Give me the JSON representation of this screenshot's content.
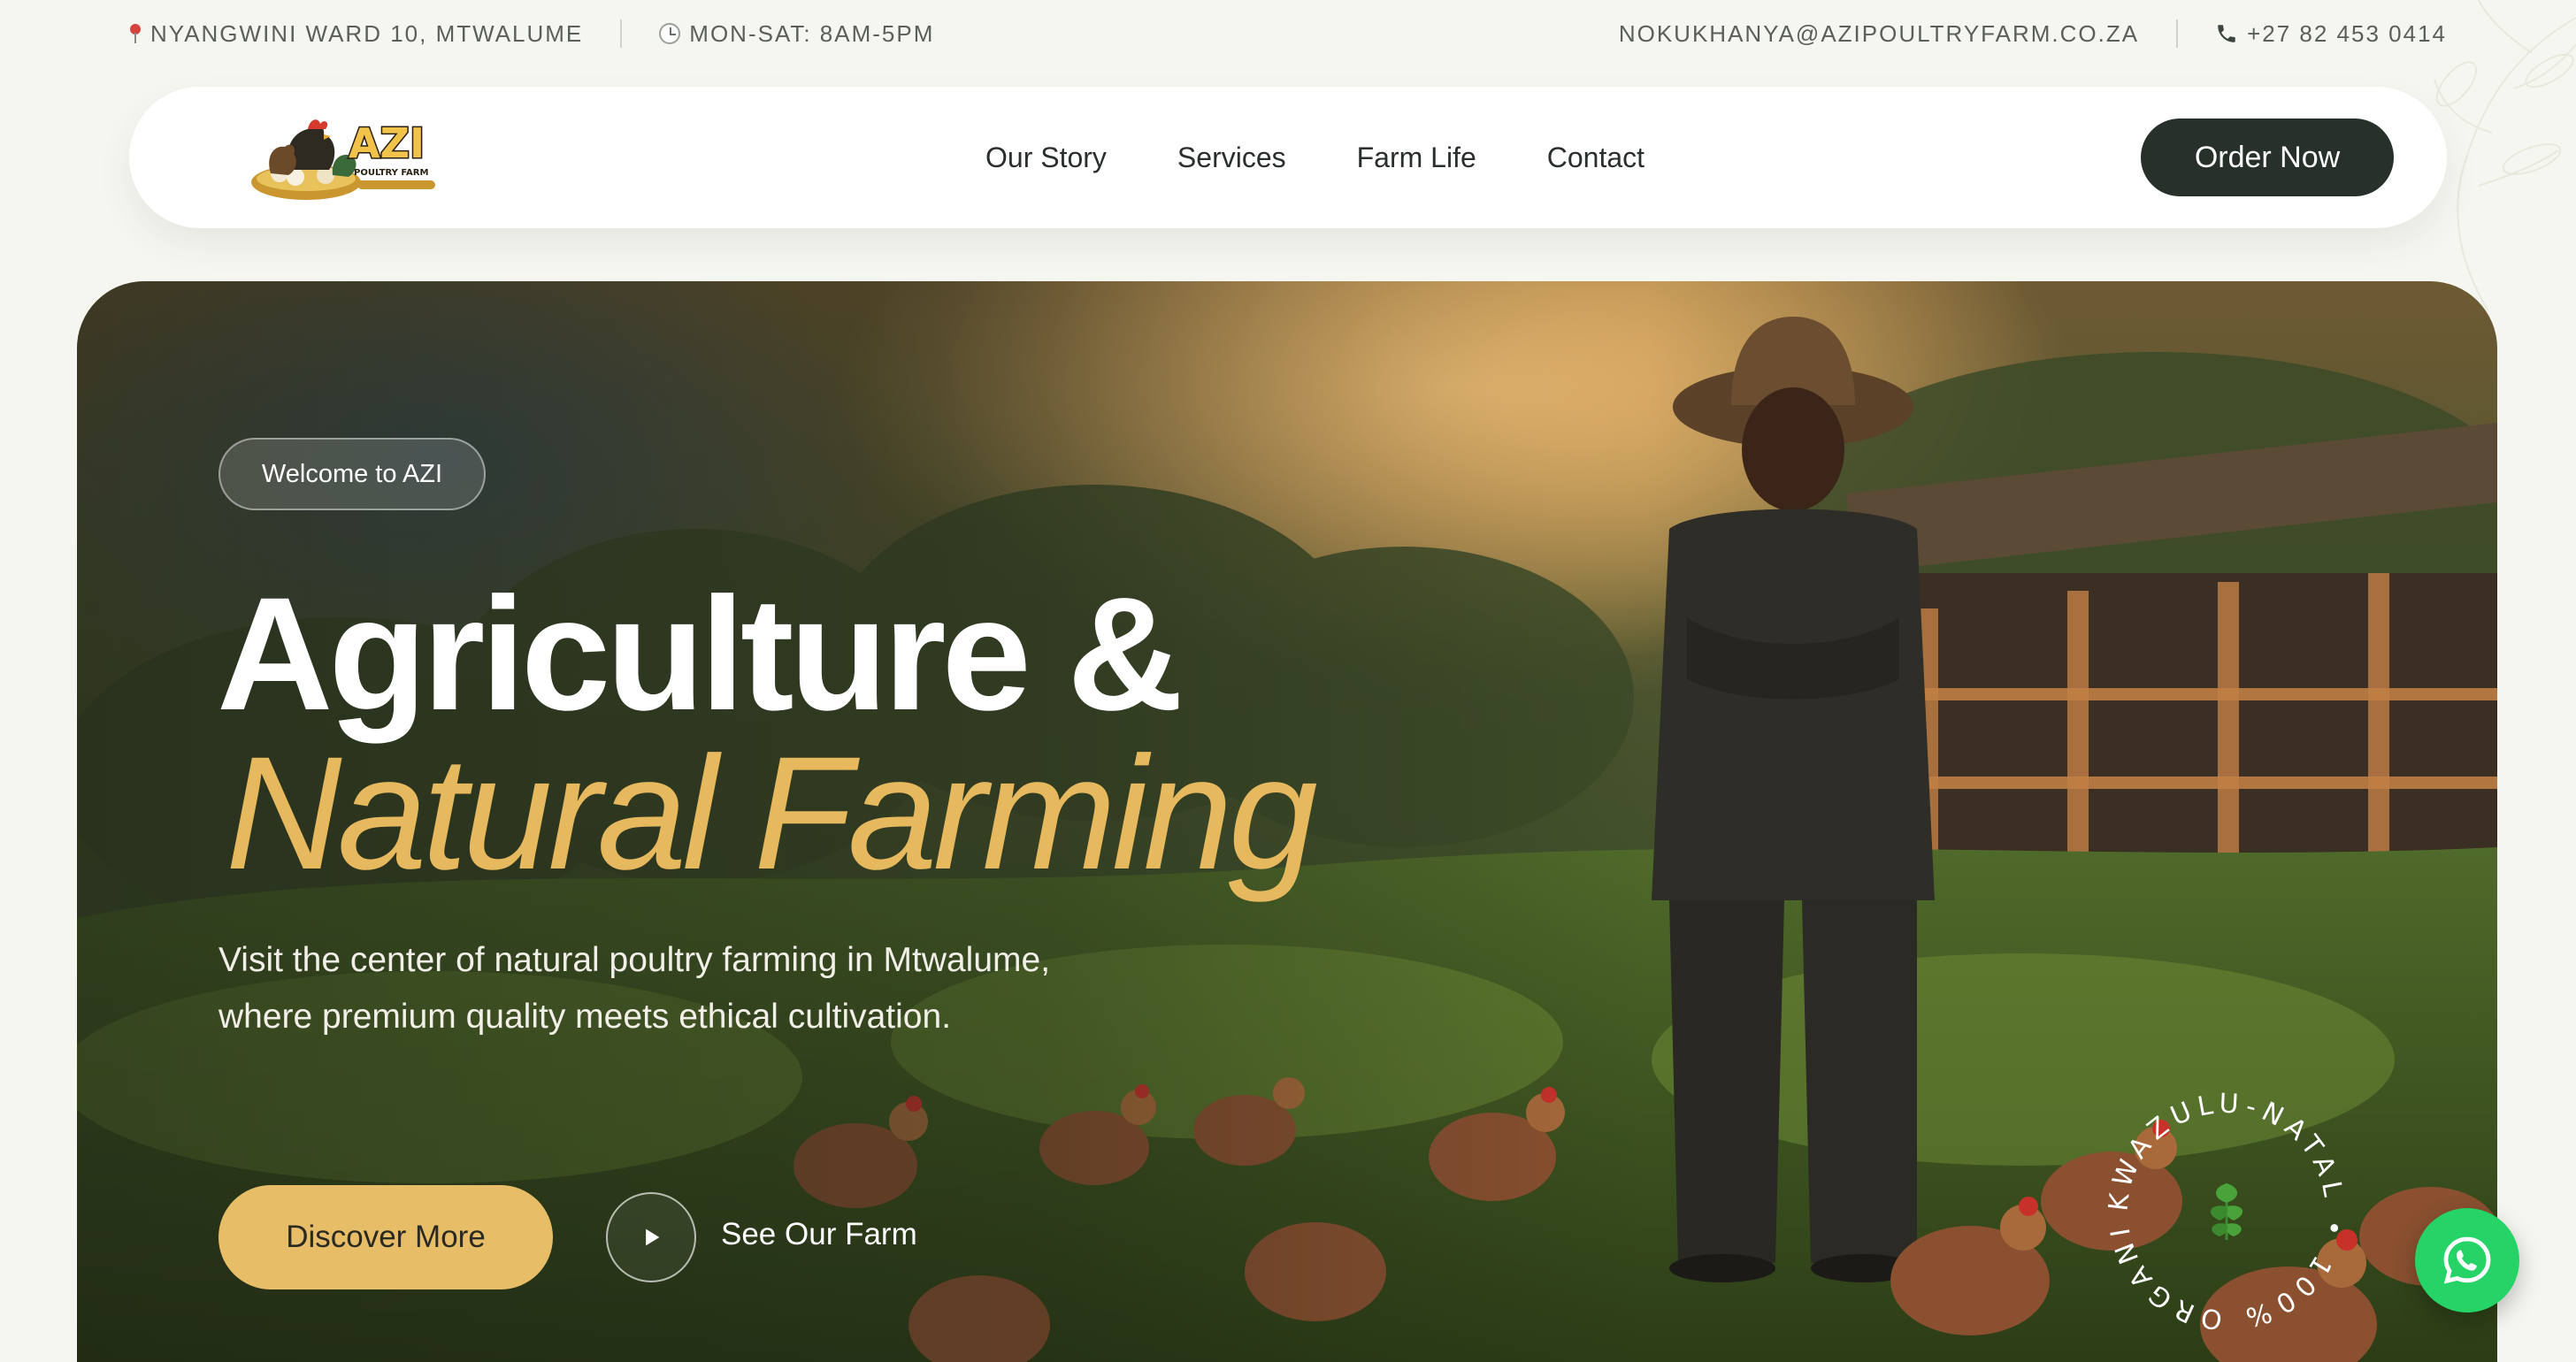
{
  "topbar": {
    "address": "NYANGWINI WARD 10, MTWALUME",
    "hours": "MON-SAT: 8AM-5PM",
    "email": "NOKUKHANYA@AZIPOULTRYFARM.CO.ZA",
    "phone": "+27 82 453 0414"
  },
  "brand": {
    "logo_text": "AZI",
    "logo_subtext": "POULTRY FARM"
  },
  "nav": {
    "links": [
      "Our Story",
      "Services",
      "Farm Life",
      "Contact"
    ],
    "cta": "Order Now"
  },
  "hero": {
    "pill": "Welcome to AZI",
    "headline_line1": "Agriculture &",
    "headline_line2": "Natural Farming",
    "description": "Visit the center of natural poultry farming in Mtwalume, where premium quality meets ethical cultivation.",
    "primary_cta": "Discover More",
    "secondary_cta": "See Our Farm",
    "badge_text": "KWAZULU-NATAL • 100% ORGANIC •"
  },
  "colors": {
    "accent": "#e7bd68",
    "dark": "#27302b",
    "headline_gold": "#e7b95f",
    "whatsapp": "#25d366"
  },
  "icons": [
    "pin-icon",
    "clock-icon",
    "phone-icon",
    "play-icon",
    "leaf-icon",
    "whatsapp-icon"
  ]
}
